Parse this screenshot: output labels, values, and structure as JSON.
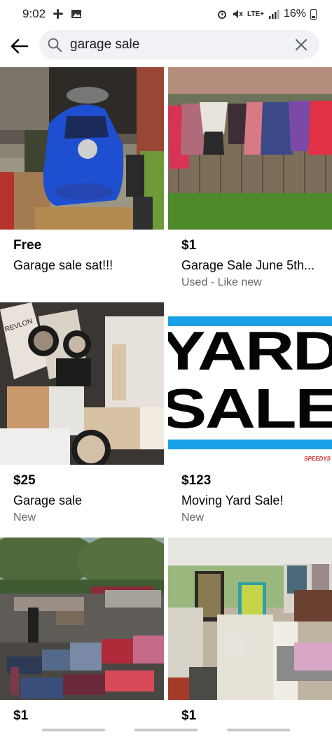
{
  "status_bar": {
    "time": "9:02",
    "network": "LTE+",
    "battery": "16%"
  },
  "search": {
    "query": "garage sale"
  },
  "listings": [
    {
      "price": "Free",
      "title": "Garage sale sat!!!",
      "condition": ""
    },
    {
      "price": "$1",
      "title": "Garage Sale June 5th...",
      "condition": "Used - Like new"
    },
    {
      "price": "$25",
      "title": "Garage sale",
      "condition": "New"
    },
    {
      "price": "$123",
      "title": "Moving Yard Sale!",
      "condition": "New"
    },
    {
      "price": "$1",
      "title": "",
      "condition": ""
    },
    {
      "price": "$1",
      "title": "",
      "condition": ""
    }
  ],
  "yard_sign": {
    "line1": "YARD",
    "line2": "SALE",
    "brand": "SPEEDYS"
  },
  "revlon_label": "REVLON"
}
